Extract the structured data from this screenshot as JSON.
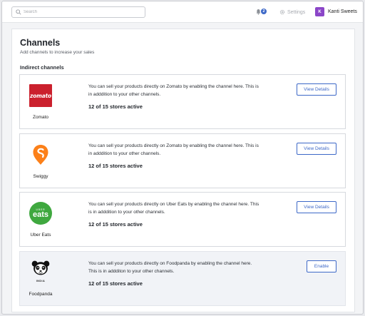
{
  "header": {
    "search": {
      "placeholder": "Search",
      "value": ""
    },
    "notifications": {
      "count": "2"
    },
    "settings_label": "Settings",
    "account": {
      "initial": "K",
      "name": "Kanti Sweets"
    }
  },
  "page": {
    "title": "Channels",
    "subtitle": "Add channels to increase your sales",
    "section_title": "Indirect channels"
  },
  "channels": [
    {
      "name": "Zomato",
      "logo_text": "zomato",
      "description": "You can sell your products directly on Zomato by enabling the channel here. This is in adddition to your other channels.",
      "stores": "12 of 15 stores active",
      "action": "View Details"
    },
    {
      "name": "Swiggy",
      "description": "You can sell your products directly on Zomato by enabling the channel here. This is in adddition to your other channels.",
      "stores": "12 of 15 stores active",
      "action": "View Details"
    },
    {
      "name": "Uber Eats",
      "logo_text_top": "Uber",
      "logo_text": "eats",
      "description": "You can sell your products directly on Uber Eats by enabling the channel here. This is in adddition to your other channels.",
      "stores": "12 of 15 stores active",
      "action": "View Details"
    },
    {
      "name": "Foodpanda",
      "logo_text": "INDIA",
      "description": "You can sell your products directly on Foodpanda by enabling the channel here. This is in addditon to your other channels.",
      "stores": "12 of 15 stores active",
      "action": "Enable"
    }
  ],
  "colors": {
    "accent": "#3d68c7",
    "avatar": "#8b46c8",
    "zomato": "#cb202d",
    "swiggy": "#fc8019",
    "ubereats": "#3fa83f"
  }
}
